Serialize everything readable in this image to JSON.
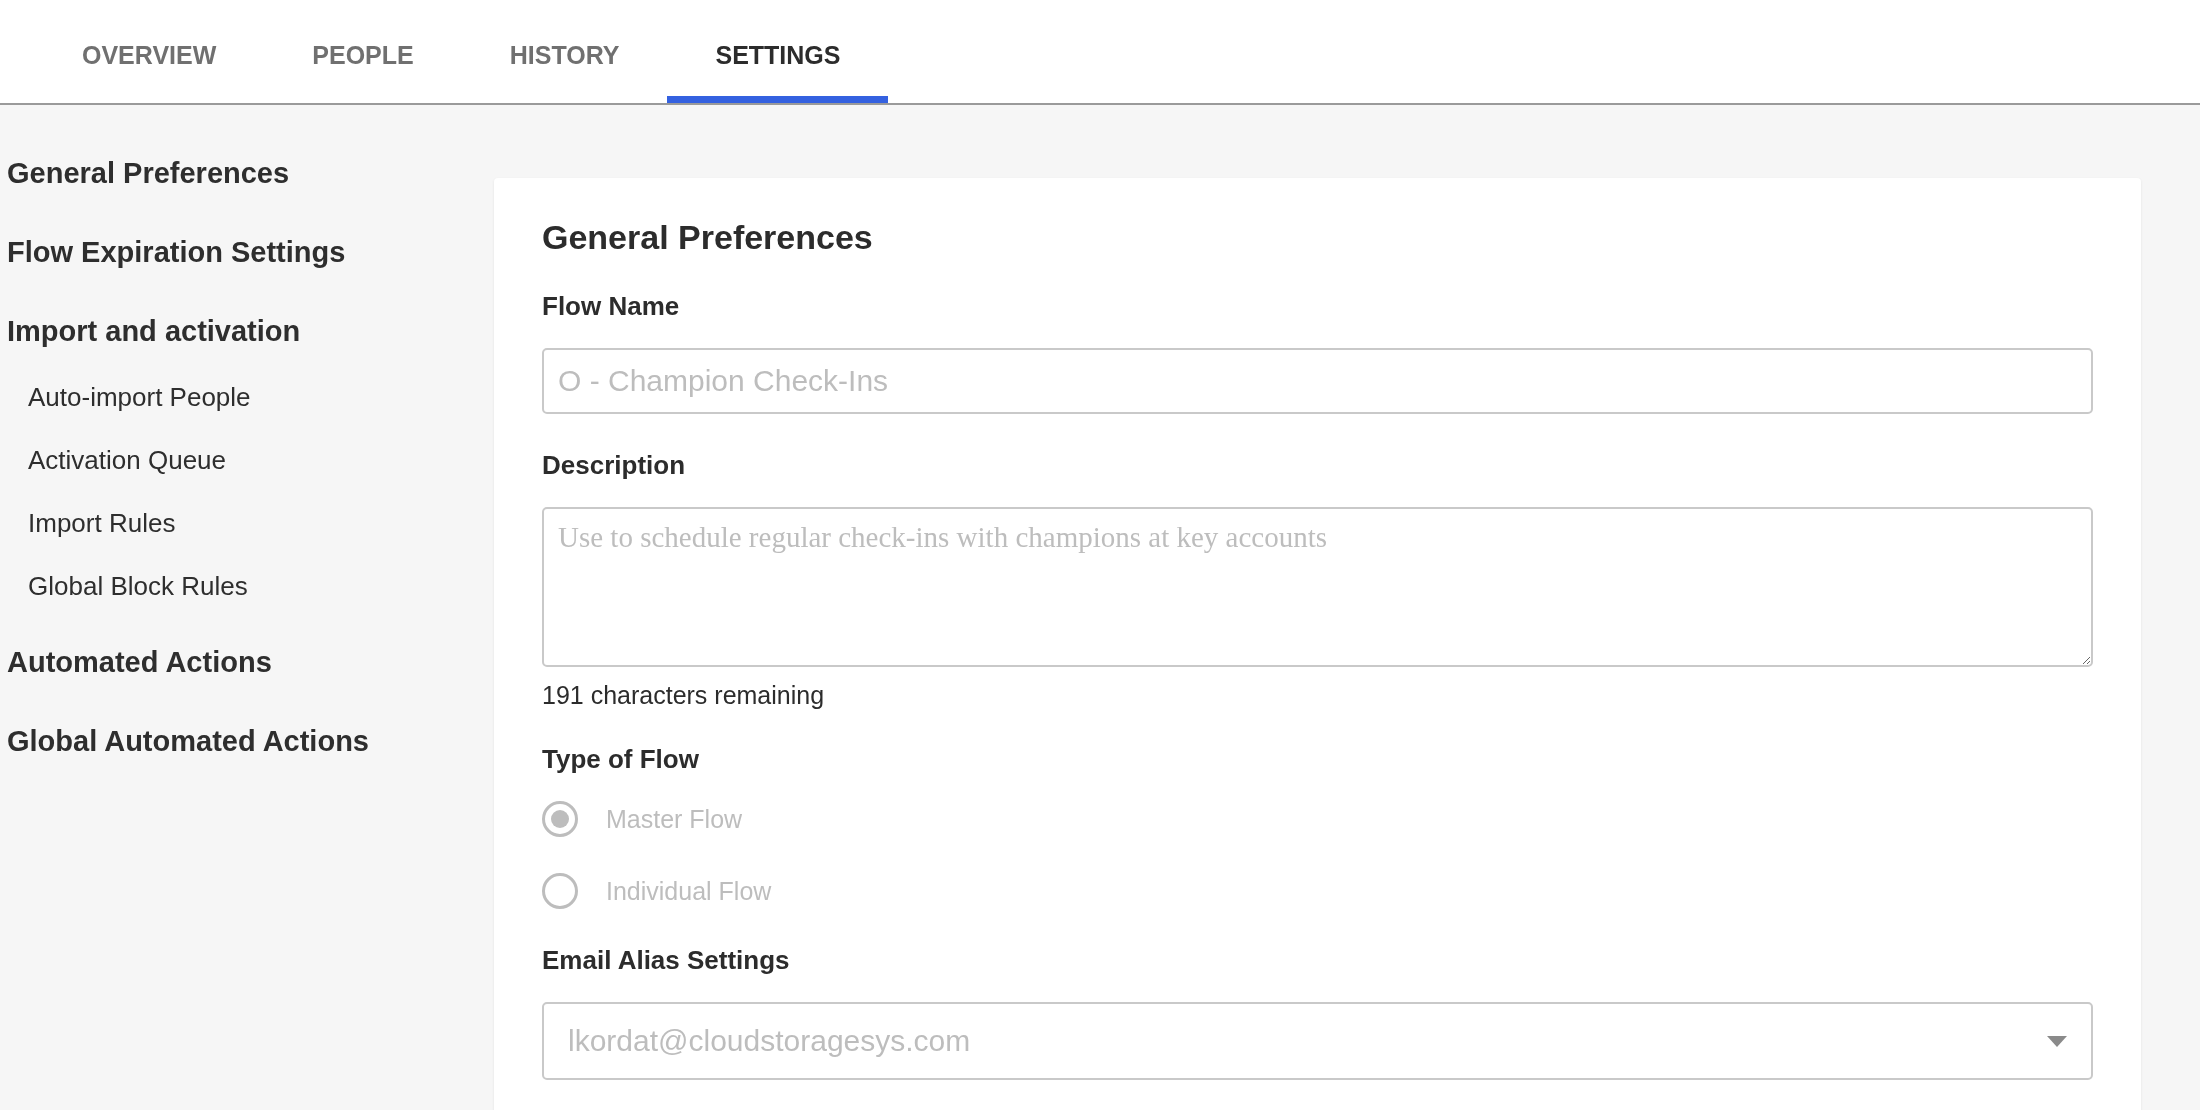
{
  "tabs": [
    {
      "label": "OVERVIEW",
      "selected": false
    },
    {
      "label": "PEOPLE",
      "selected": false
    },
    {
      "label": "HISTORY",
      "selected": false
    },
    {
      "label": "SETTINGS",
      "selected": true
    }
  ],
  "sidebar": {
    "items": [
      {
        "label": "General Preferences"
      },
      {
        "label": "Flow Expiration Settings"
      },
      {
        "label": "Import and activation",
        "children": [
          {
            "label": "Auto-import People"
          },
          {
            "label": "Activation Queue"
          },
          {
            "label": "Import Rules"
          },
          {
            "label": "Global Block Rules"
          }
        ]
      },
      {
        "label": "Automated Actions"
      },
      {
        "label": "Global Automated Actions"
      }
    ]
  },
  "card": {
    "title": "General Preferences",
    "flow_name": {
      "label": "Flow Name",
      "placeholder": "O - Champion Check-Ins"
    },
    "description": {
      "label": "Description",
      "placeholder": "Use to schedule regular check-ins with champions at key accounts",
      "counter": "191 characters remaining"
    },
    "type_of_flow": {
      "label": "Type of Flow",
      "disabled": true,
      "options": [
        {
          "label": "Master Flow",
          "selected": true
        },
        {
          "label": "Individual Flow",
          "selected": false
        }
      ]
    },
    "email_alias": {
      "label": "Email Alias Settings",
      "placeholder": "lkordat@cloudstoragesys.com"
    }
  }
}
